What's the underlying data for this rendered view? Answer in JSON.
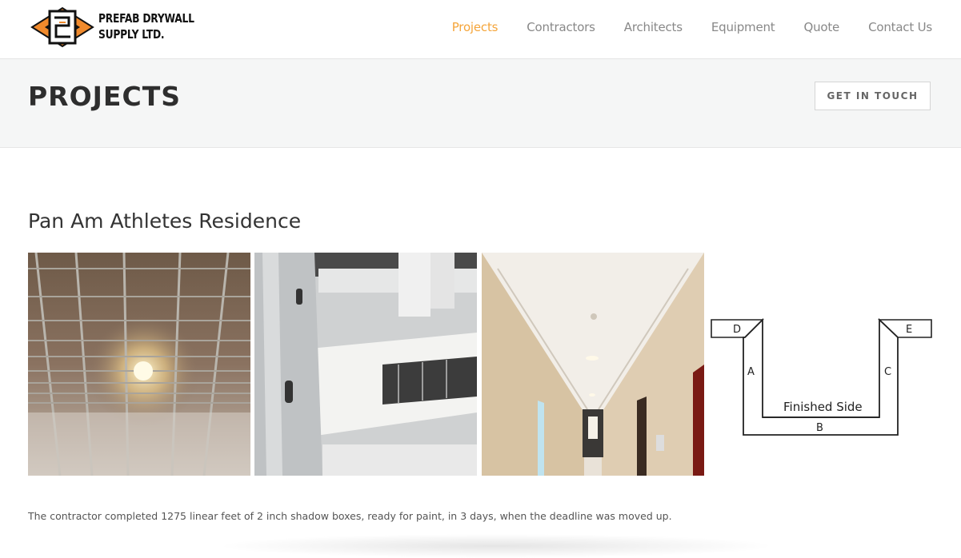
{
  "header": {
    "brand_line1": "PREFAB DRYWALL",
    "brand_line2": "SUPPLY LTD.",
    "nav": [
      {
        "label": "Projects"
      },
      {
        "label": "Contractors"
      },
      {
        "label": "Architects"
      },
      {
        "label": "Equipment"
      },
      {
        "label": "Quote"
      },
      {
        "label": "Contact Us"
      }
    ],
    "active_color": "#f5a53a"
  },
  "titlebar": {
    "title": "PROJECTS",
    "cta_label": "GET IN TOUCH"
  },
  "project": {
    "name": "Pan Am Athletes Residence",
    "description": "The contractor completed 1275 linear feet of 2 inch shadow boxes, ready for paint, in 3 days, when the deadline was moved up.",
    "diagram": {
      "labels": {
        "a": "A",
        "b": "B",
        "c": "C",
        "d": "D",
        "e": "E"
      },
      "finished_side": "Finished Side"
    }
  },
  "icons": {
    "logo": "prefab-drywall-logo",
    "photo1": "ceiling-steel-framing",
    "photo2": "drywall-bulkhead-framing",
    "photo3": "finished-hallway"
  }
}
